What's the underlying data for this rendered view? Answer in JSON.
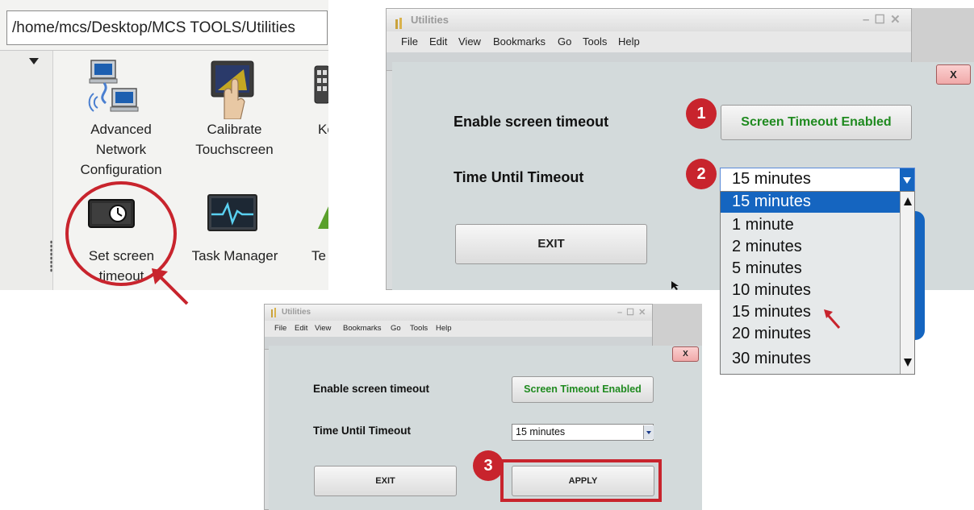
{
  "file_manager": {
    "path": "/home/mcs/Desktop/MCS TOOLS/Utilities",
    "icons": [
      {
        "label_lines": [
          "Advanced",
          "Network",
          "Configuration"
        ]
      },
      {
        "label_lines": [
          "Calibrate",
          "Touchscreen"
        ]
      },
      {
        "label_lines": [
          "Ke"
        ]
      },
      {
        "label_lines": [
          "Set screen",
          "timeout"
        ]
      },
      {
        "label_lines": [
          "Task Manager"
        ]
      },
      {
        "label_lines": [
          "Te"
        ]
      }
    ]
  },
  "window": {
    "title": "Utilities",
    "menu": [
      "File",
      "Edit",
      "View",
      "Bookmarks",
      "Go",
      "Tools",
      "Help"
    ],
    "close_label": "X"
  },
  "dialog": {
    "enable_label": "Enable screen timeout",
    "enable_button": "Screen Timeout Enabled",
    "timeout_label": "Time Until Timeout",
    "selected_value": "15 minutes",
    "exit_label": "EXIT",
    "apply_label": "APPLY",
    "options": [
      "15 minutes",
      "1 minute",
      "2 minutes",
      "5 minutes",
      "10 minutes",
      "15 minutes",
      "20 minutes",
      "30 minutes"
    ]
  },
  "steps": [
    "1",
    "2",
    "3"
  ],
  "colors": {
    "badge": "#c8242d",
    "highlight": "#1565c0",
    "enabled_text": "#1f8a1f",
    "annotation": "#c8242d"
  }
}
